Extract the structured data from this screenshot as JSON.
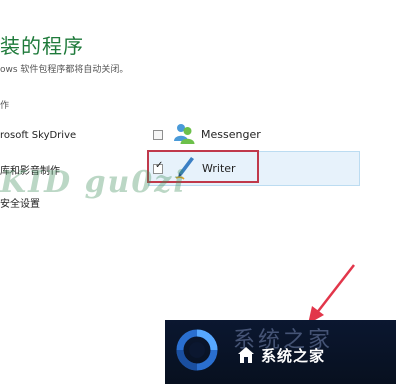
{
  "dialog": {
    "title": "装的程序",
    "subtitle": "ows 软件包程序都将自动关闭。",
    "section_label": "作",
    "left_items": [
      {
        "label": "rosoft SkyDrive"
      },
      {
        "label": "库和影音制作"
      },
      {
        "label": "安全设置"
      }
    ]
  },
  "programs": [
    {
      "label": "Messenger",
      "checked": false,
      "icon": "messenger-icon"
    },
    {
      "label": "Writer",
      "checked": true,
      "icon": "writer-pen-icon"
    }
  ],
  "overlay": {
    "watermark": "KID gu0zi",
    "highlight_color": "#c0394b",
    "arrow_color": "#e2364a"
  },
  "brand": {
    "ghost_text": "系统之家",
    "name": "系统之家",
    "icon": "brand-ring-logo"
  }
}
